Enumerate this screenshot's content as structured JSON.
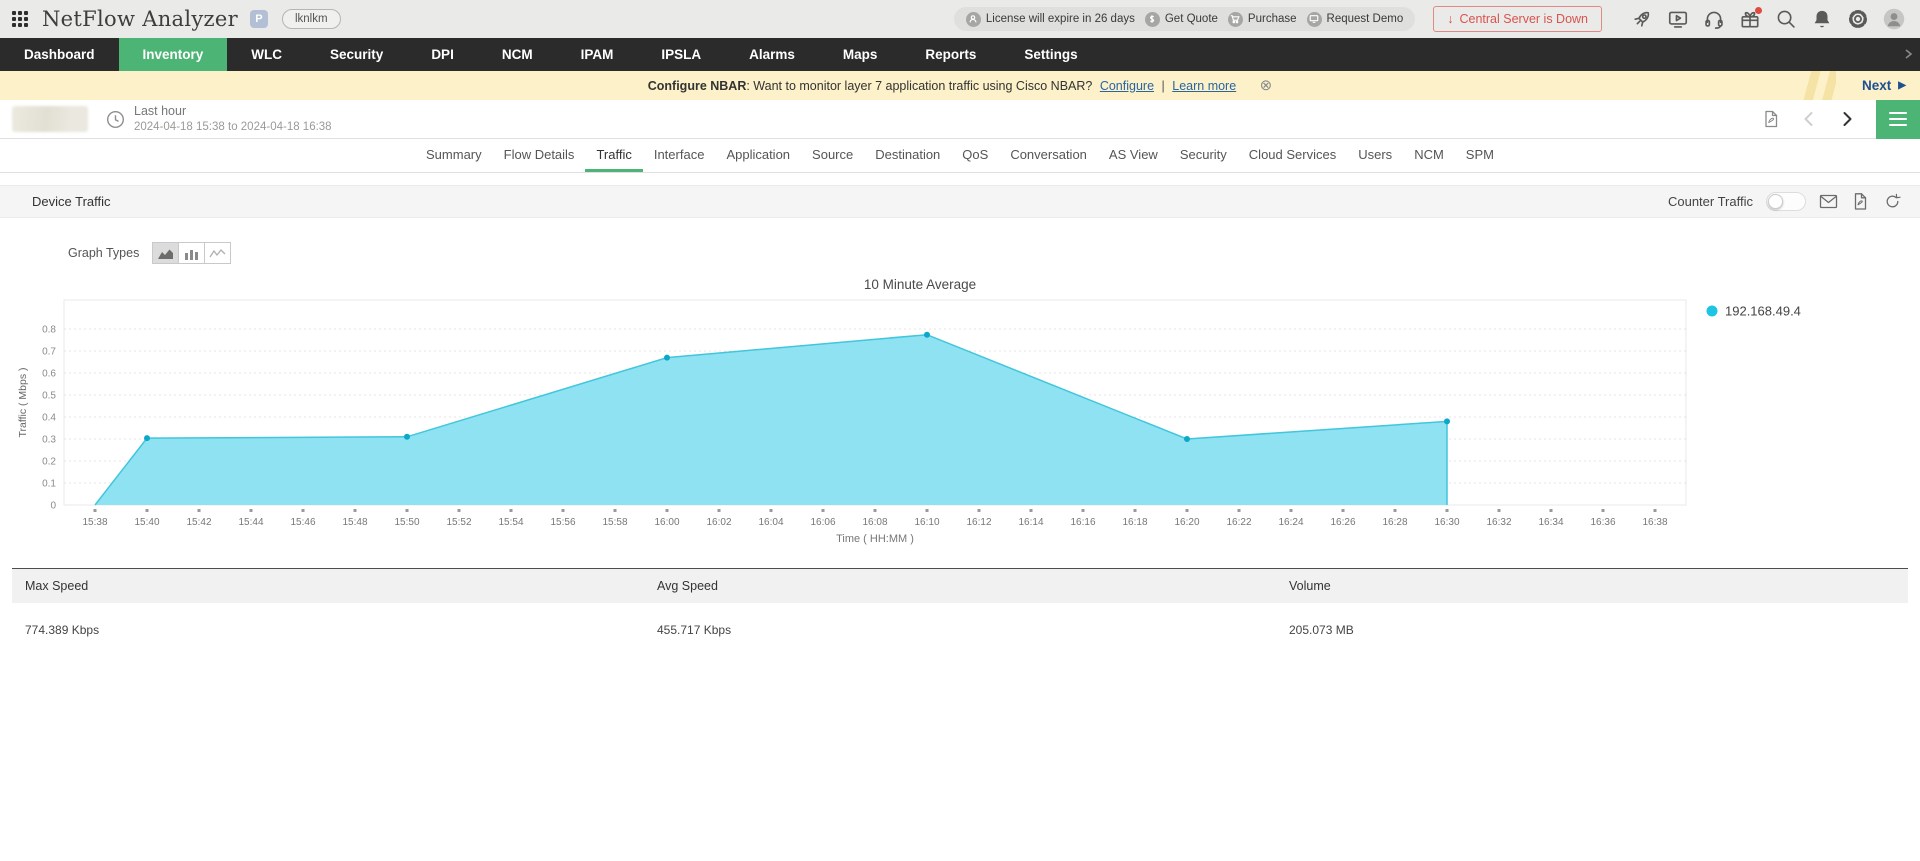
{
  "topbar": {
    "title": "NetFlow Analyzer",
    "badge": "P",
    "pill_label": "lknlkm",
    "license_text": "License will expire in 26 days",
    "get_quote": "Get Quote",
    "purchase": "Purchase",
    "request_demo": "Request Demo",
    "central_server": "Central Server is Down",
    "icon_names": [
      "rocket-icon",
      "presentation-icon",
      "headset-icon",
      "gift-icon",
      "search-icon",
      "bell-icon",
      "gear-icon",
      "avatar"
    ]
  },
  "nav": {
    "items": [
      "Dashboard",
      "Inventory",
      "WLC",
      "Security",
      "DPI",
      "NCM",
      "IPAM",
      "IPSLA",
      "Alarms",
      "Maps",
      "Reports",
      "Settings"
    ],
    "active": "Inventory"
  },
  "banner": {
    "bold_label": "Configure NBAR",
    "message": ": Want to monitor layer 7 application traffic using Cisco NBAR?",
    "configure_label": "Configure",
    "separator": "|",
    "learn_more_label": "Learn more",
    "next_label": "Next"
  },
  "toolbar": {
    "range_label": "Last hour",
    "range_dates": "2024-04-18 15:38 to 2024-04-18 16:38"
  },
  "tabs": [
    "Summary",
    "Flow Details",
    "Traffic",
    "Interface",
    "Application",
    "Source",
    "Destination",
    "QoS",
    "Conversation",
    "AS View",
    "Security",
    "Cloud Services",
    "Users",
    "NCM",
    "SPM"
  ],
  "active_tab": "Traffic",
  "section": {
    "title": "Device Traffic",
    "counter_label": "Counter Traffic",
    "toggle_state": "off"
  },
  "graph_types": {
    "label": "Graph Types",
    "options": [
      "area",
      "bar",
      "line"
    ],
    "selected": "area"
  },
  "chart_data": {
    "type": "area",
    "title": "10 Minute Average",
    "xlabel": "Time ( HH:MM )",
    "ylabel": "Traffic ( Mbps )",
    "ylim": [
      0,
      0.8
    ],
    "ytick_step": 0.1,
    "grid": "dotted-horizontal",
    "legend_position": "right",
    "x_start": "15:38",
    "x_end": "16:38",
    "x_ticks": [
      "15:38",
      "15:40",
      "15:42",
      "15:44",
      "15:46",
      "15:48",
      "15:50",
      "15:52",
      "15:54",
      "15:56",
      "15:58",
      "16:00",
      "16:02",
      "16:04",
      "16:06",
      "16:08",
      "16:10",
      "16:12",
      "16:14",
      "16:16",
      "16:18",
      "16:20",
      "16:22",
      "16:24",
      "16:26",
      "16:28",
      "16:30",
      "16:32",
      "16:34",
      "16:36",
      "16:38"
    ],
    "series": [
      {
        "name": "192.168.49.4",
        "color": "#41c6dc",
        "fill": "#8fe2f1",
        "marker_color": "#0ca8ca",
        "points": [
          [
            "15:38",
            0
          ],
          [
            "15:40",
            0.304
          ],
          [
            "15:50",
            0.31
          ],
          [
            "16:00",
            0.67
          ],
          [
            "16:10",
            0.774
          ],
          [
            "16:20",
            0.3
          ],
          [
            "16:30",
            0.38
          ],
          [
            "16:30",
            0
          ]
        ],
        "marker_points": [
          [
            "15:40",
            0.304
          ],
          [
            "15:50",
            0.31
          ],
          [
            "16:00",
            0.67
          ],
          [
            "16:10",
            0.774
          ],
          [
            "16:20",
            0.3
          ],
          [
            "16:30",
            0.38
          ]
        ]
      }
    ]
  },
  "table": {
    "headers": [
      "Max Speed",
      "Avg Speed",
      "Volume"
    ],
    "rows": [
      [
        "774.389 Kbps",
        "455.717 Kbps",
        "205.073 MB"
      ]
    ]
  },
  "icons": {
    "down_arrow": "↓",
    "play": "▶",
    "dismiss": "⊗"
  },
  "colors": {
    "accent_green": "#4cb575",
    "nav_bg": "#2b2b2b",
    "banner_bg": "#fcf1c9",
    "alert_red": "#d9534f",
    "area_fill": "#8fe2f1",
    "area_stroke": "#41c6dc",
    "legend_dot": "#1ec4e4",
    "badge_bg": "#b3bfd4"
  }
}
